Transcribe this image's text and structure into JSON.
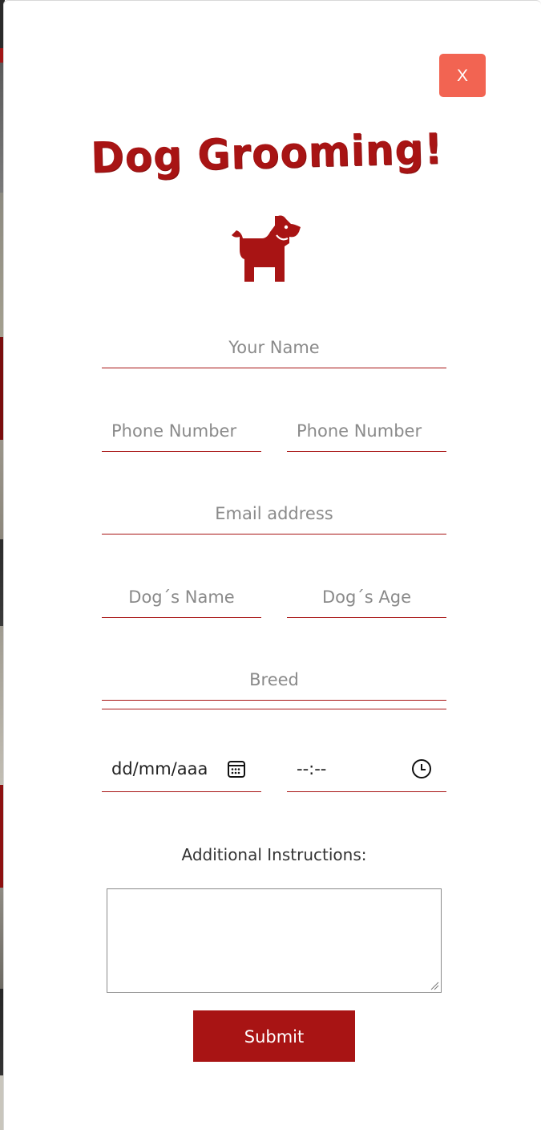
{
  "modal": {
    "close_label": "X",
    "title": "Dog Grooming!",
    "icon": "dog-icon"
  },
  "form": {
    "name": {
      "placeholder": "Your Name"
    },
    "phone1": {
      "placeholder": "Phone Number"
    },
    "phone2": {
      "placeholder": "Phone Number"
    },
    "email": {
      "placeholder": "Email address"
    },
    "dog_name": {
      "placeholder": "Dog´s Name"
    },
    "dog_age": {
      "placeholder": "Dog´s Age"
    },
    "breed": {
      "placeholder": "Breed"
    },
    "date": {
      "value": "dd/mm/aaaa",
      "icon": "calendar-icon"
    },
    "time": {
      "value": "--:--",
      "icon": "clock-icon"
    },
    "instructions_label": "Additional Instructions:",
    "submit_label": "Submit"
  },
  "colors": {
    "brand": "#a81414",
    "close_button": "#f26452"
  }
}
